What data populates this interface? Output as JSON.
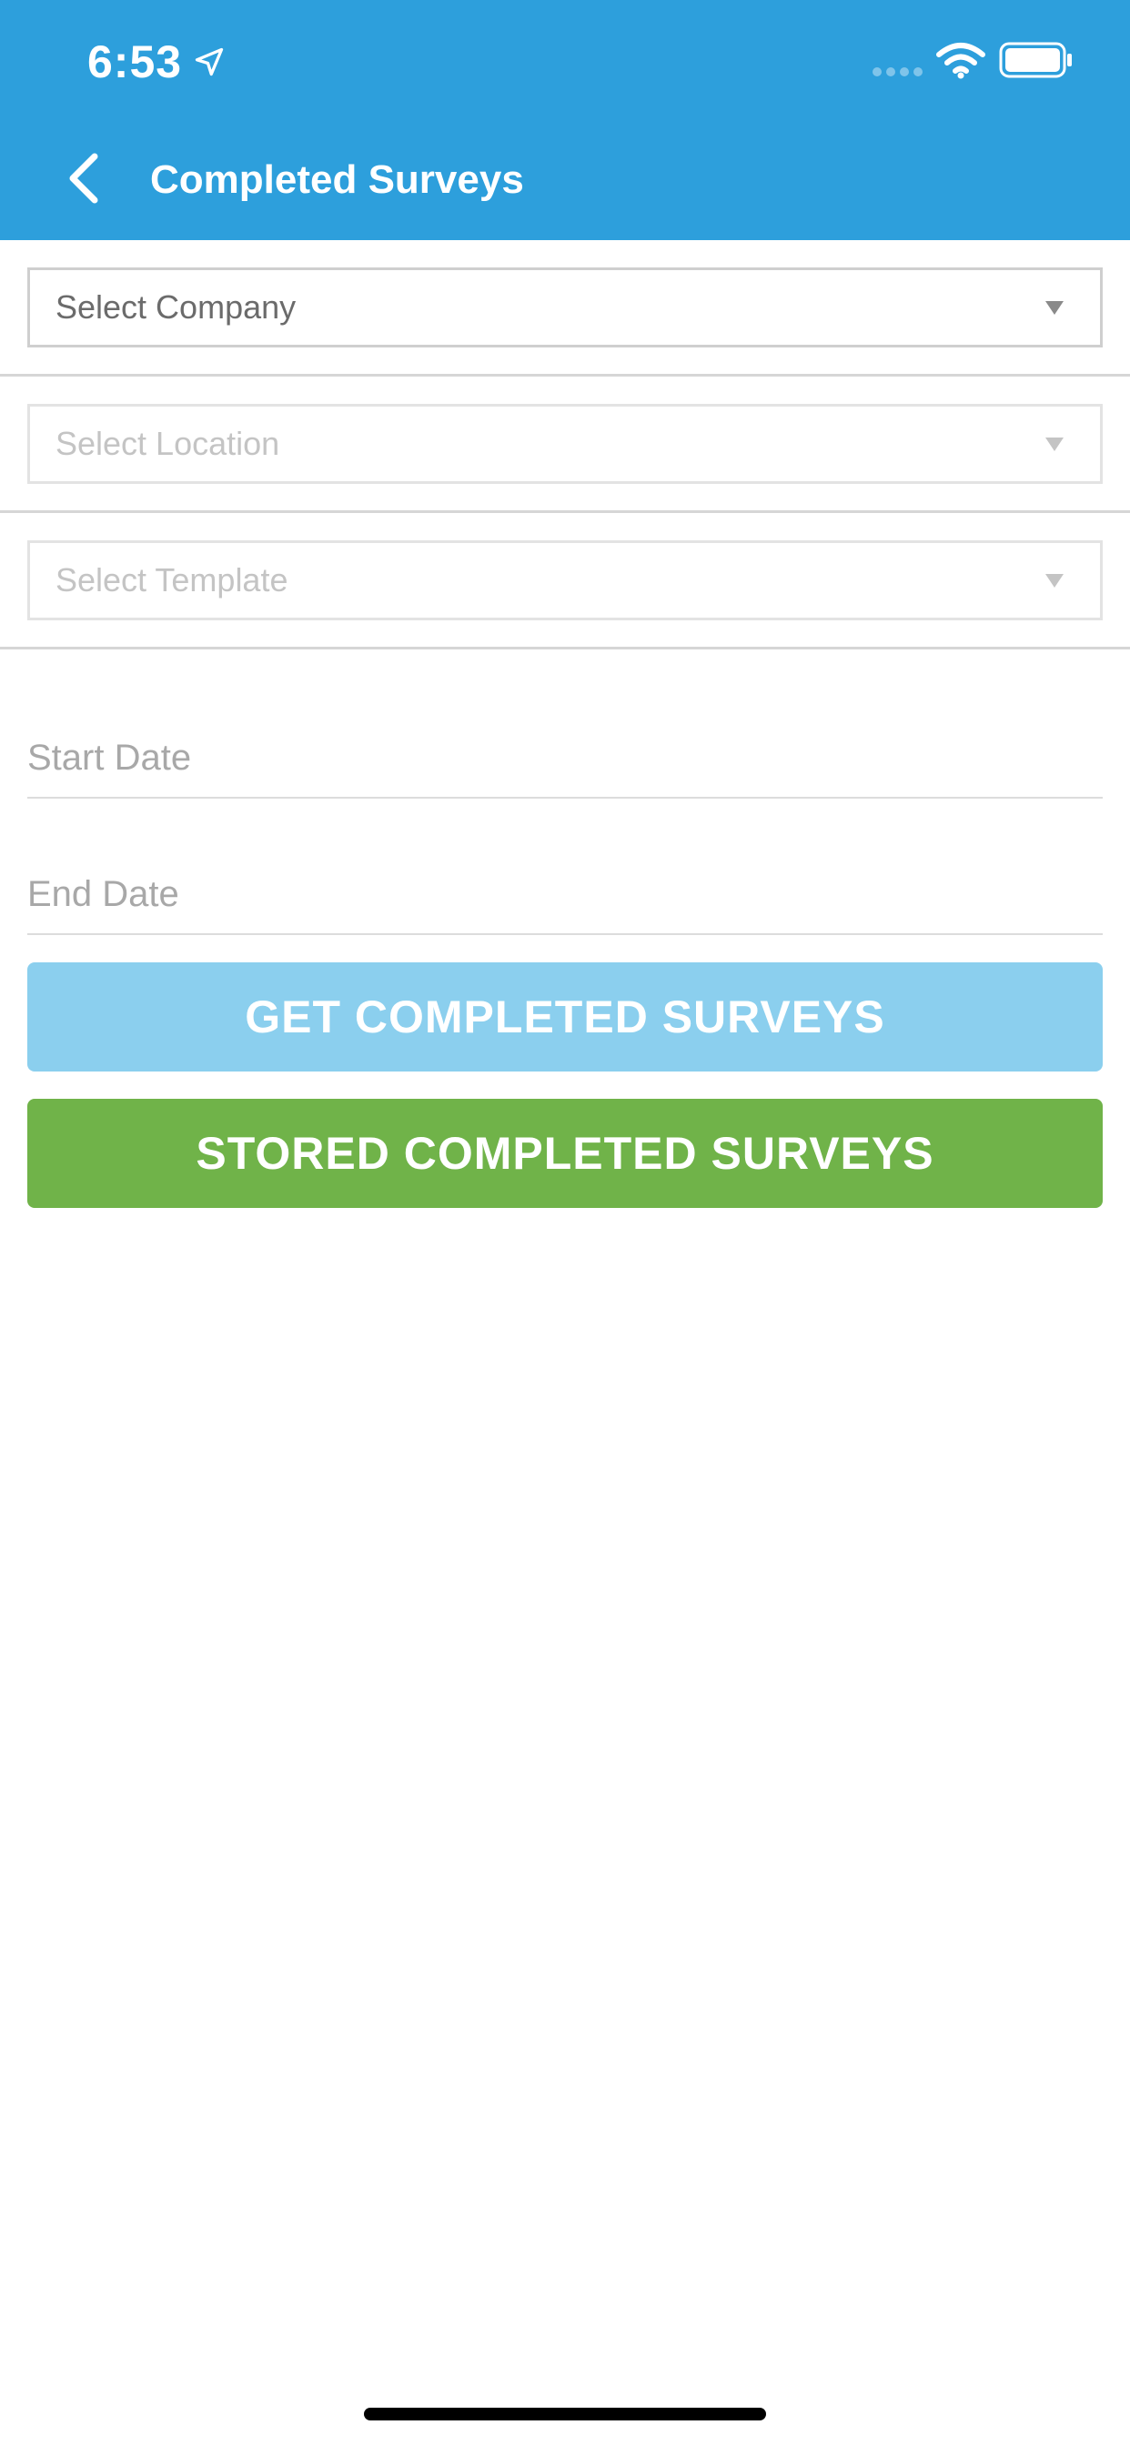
{
  "status_bar": {
    "time": "6:53"
  },
  "header": {
    "title": "Completed Surveys",
    "background_color": "#2d9fdc"
  },
  "filters": {
    "company": {
      "label": "Select Company",
      "enabled": true
    },
    "location": {
      "label": "Select Location",
      "enabled": false
    },
    "template": {
      "label": "Select Template",
      "enabled": false
    }
  },
  "dates": {
    "start_placeholder": "Start Date",
    "end_placeholder": "End Date"
  },
  "buttons": {
    "get_label": "GET COMPLETED SURVEYS",
    "get_color": "#8bcfee",
    "stored_label": "STORED COMPLETED SURVEYS",
    "stored_color": "#70b349"
  }
}
